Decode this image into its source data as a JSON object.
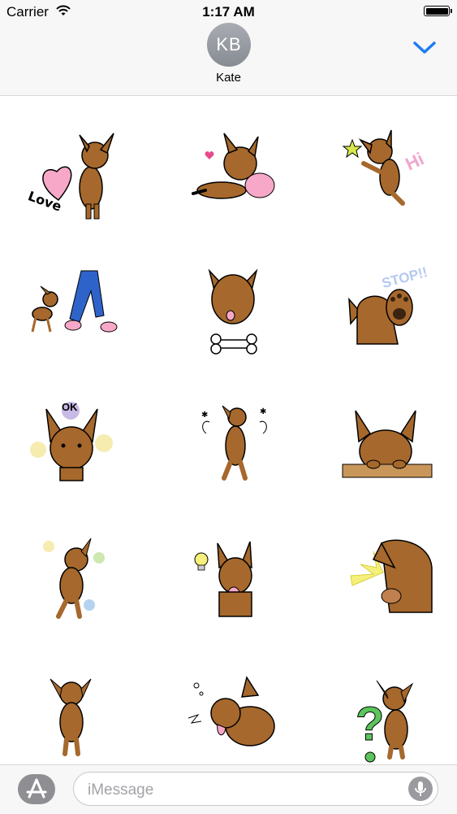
{
  "status_bar": {
    "carrier": "Carrier",
    "time": "1:17 AM",
    "wifi_icon": "wifi-icon",
    "battery_icon": "battery-icon"
  },
  "header": {
    "avatar_initials": "KB",
    "contact_name": "Kate",
    "collapse_icon": "chevron-down-icon",
    "accent_color": "#1e7cf2"
  },
  "stickers": [
    {
      "label": "Love",
      "icon": "dog-heart-love-sticker"
    },
    {
      "label": "",
      "icon": "dog-lying-sticker"
    },
    {
      "label": "Hi",
      "icon": "dog-hi-sticker"
    },
    {
      "label": "",
      "icon": "dog-walking-feet-sticker"
    },
    {
      "label": "",
      "icon": "dog-bone-sticker"
    },
    {
      "label": "STOP!!",
      "icon": "dog-stop-paw-sticker"
    },
    {
      "label": "OK",
      "icon": "dog-ok-sticker"
    },
    {
      "label": "",
      "icon": "dog-dizzy-sticker"
    },
    {
      "label": "",
      "icon": "dog-peeking-sticker"
    },
    {
      "label": "",
      "icon": "dog-music-sticker"
    },
    {
      "label": "",
      "icon": "dog-idea-bulb-sticker"
    },
    {
      "label": "",
      "icon": "dog-bump-sticker"
    },
    {
      "label": "",
      "icon": "dog-shy-sticker"
    },
    {
      "label": "",
      "icon": "dog-sick-sticker"
    },
    {
      "label": "?",
      "icon": "dog-question-sticker"
    }
  ],
  "compose": {
    "placeholder": "iMessage",
    "app_store_icon": "app-store-icon",
    "mic_icon": "microphone-icon"
  },
  "colors": {
    "dog_brown": "#a6682c",
    "dog_dark": "#7a4b1d",
    "pink": "#f7a8c8",
    "bar_bg": "#f7f7f7"
  }
}
